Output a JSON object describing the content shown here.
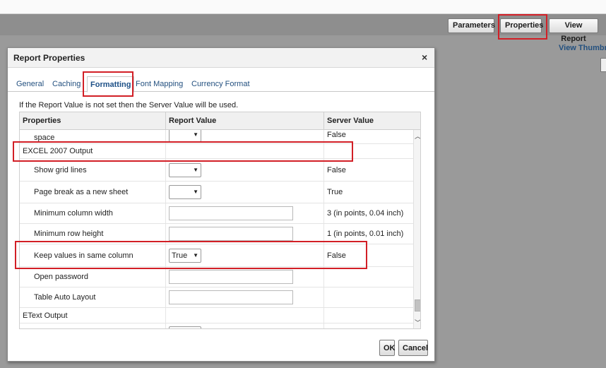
{
  "toolbar": {
    "parameters_label": "Parameters",
    "properties_label": "Properties",
    "view_report_label": "View Report",
    "view_thumbnails_label": "View Thumbn"
  },
  "dialog": {
    "title": "Report Properties",
    "close_label": "×",
    "tabs": [
      "General",
      "Caching",
      "Formatting",
      "Font Mapping",
      "Currency Format"
    ],
    "active_tab": "Formatting",
    "note": "If the Report Value is not set then the Server Value will be used.",
    "columns": [
      "Properties",
      "Report Value",
      "Server Value"
    ],
    "rows": {
      "r0": {
        "label": "Remove leading and trailing white space",
        "label_visible": "space",
        "report_value": "",
        "server_value": "False"
      },
      "r1": {
        "label": "EXCEL 2007 Output"
      },
      "r2": {
        "label": "Show grid lines",
        "report_value": "",
        "server_value": "False"
      },
      "r3": {
        "label": "Page break as a new sheet",
        "report_value": "",
        "server_value": "True"
      },
      "r4": {
        "label": "Minimum column width",
        "report_value": "",
        "server_value": "3 (in points, 0.04 inch)"
      },
      "r5": {
        "label": "Minimum row height",
        "report_value": "",
        "server_value": "1 (in points, 0.01 inch)"
      },
      "r6": {
        "label": "Keep values in same column",
        "report_value": "True",
        "server_value": "False"
      },
      "r7": {
        "label": "Open password",
        "report_value": "",
        "server_value": ""
      },
      "r8": {
        "label": "Table Auto Layout",
        "report_value": "",
        "server_value": ""
      },
      "r9": {
        "label": "EText Output"
      }
    },
    "ok_label": "OK",
    "cancel_label": "Cancel"
  },
  "icons": {
    "dropdown": "chevron-down-icon",
    "scroll_up": "chevron-up-icon",
    "scroll_down": "chevron-down-icon",
    "close": "close-icon"
  },
  "colors": {
    "highlight": "#d21f26",
    "link": "#23507f"
  }
}
